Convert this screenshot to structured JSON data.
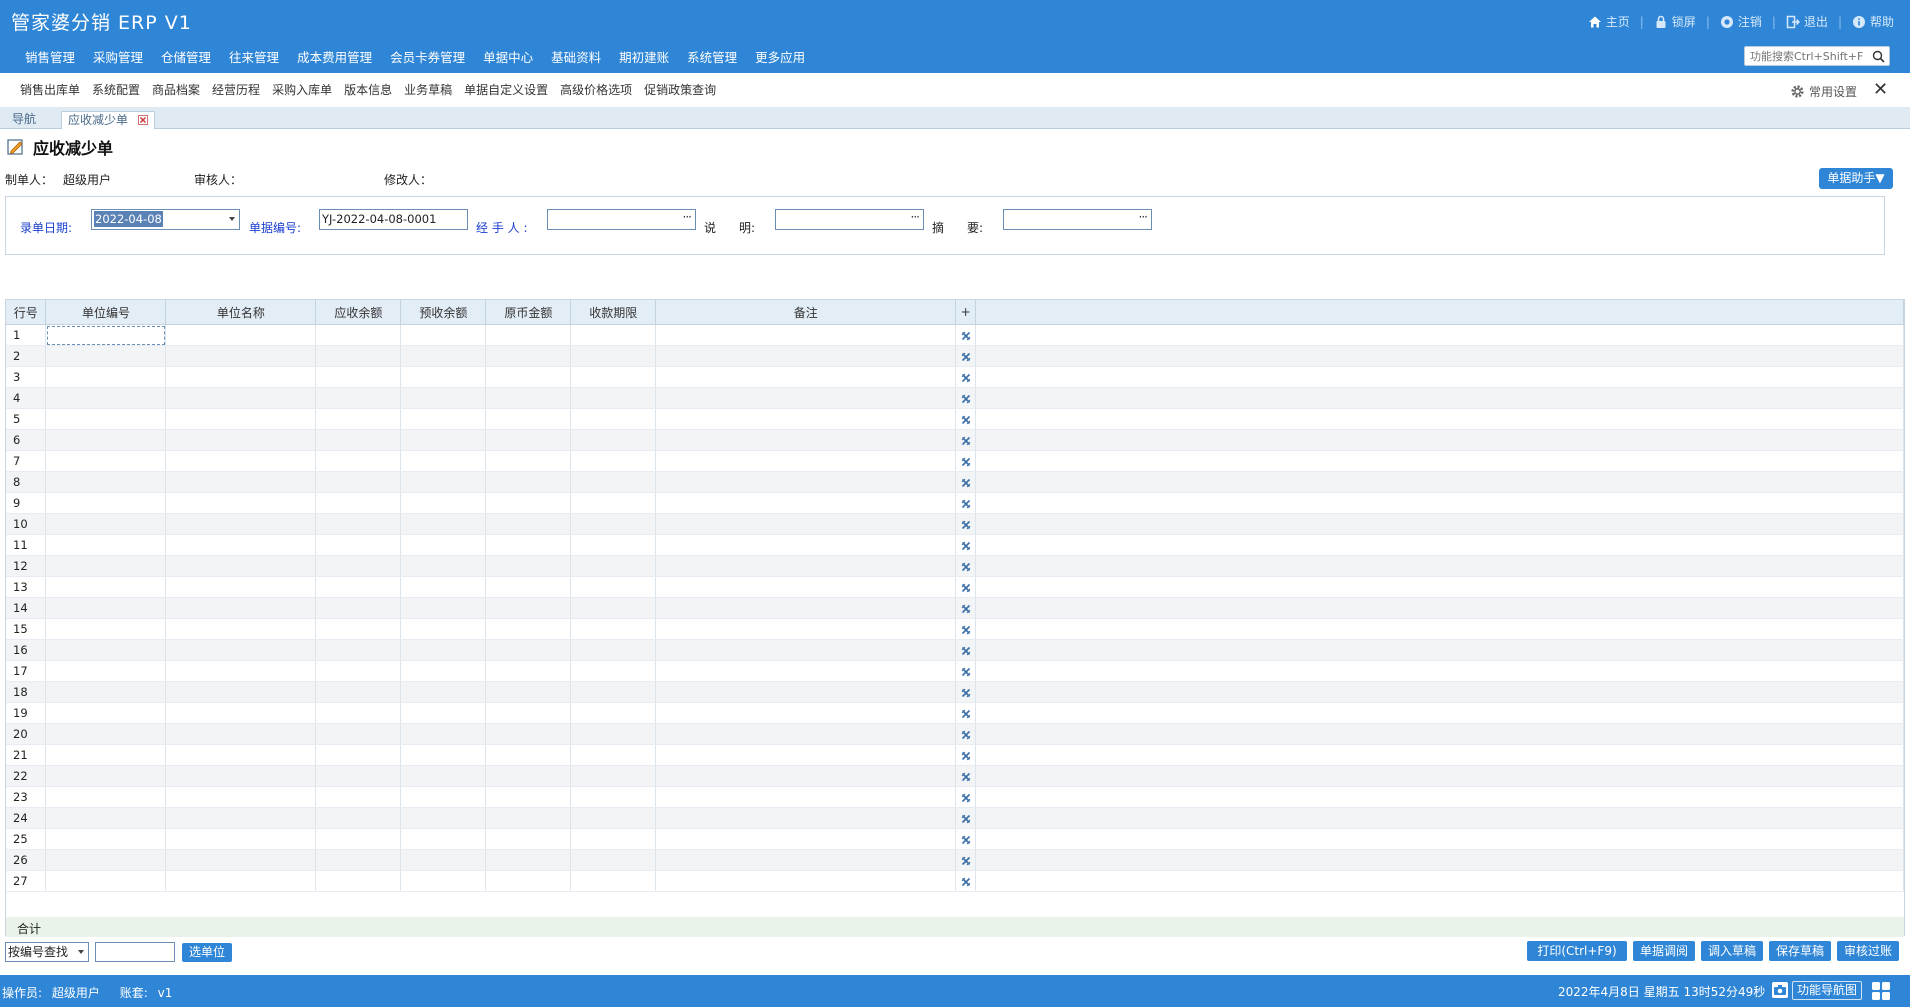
{
  "app": {
    "title": "管家婆分销 ERP V1"
  },
  "top_links": [
    {
      "label": "主页",
      "icon": "home-icon"
    },
    {
      "label": "锁屏",
      "icon": "lock-icon"
    },
    {
      "label": "注销",
      "icon": "logout-circle-icon"
    },
    {
      "label": "退出",
      "icon": "exit-icon"
    },
    {
      "label": "帮助",
      "icon": "info-icon"
    }
  ],
  "main_nav": [
    "销售管理",
    "采购管理",
    "仓储管理",
    "往来管理",
    "成本费用管理",
    "会员卡券管理",
    "单据中心",
    "基础资料",
    "期初建账",
    "系统管理",
    "更多应用"
  ],
  "search": {
    "placeholder": "功能搜索Ctrl+Shift+F"
  },
  "sub_nav": [
    "销售出库单",
    "系统配置",
    "商品档案",
    "经营历程",
    "采购入库单",
    "版本信息",
    "业务草稿",
    "单据自定义设置",
    "高级价格选项",
    "促销政策查询"
  ],
  "common_settings": "常用设置",
  "tabs": [
    {
      "label": "导航"
    },
    {
      "label": "应收减少单"
    }
  ],
  "document": {
    "title": "应收减少单",
    "creator_label": "制单人：",
    "creator_value": "超级用户",
    "auditor_label": "审核人：",
    "modifier_label": "修改人：",
    "helper_button": "单据助手▼"
  },
  "form": {
    "date_label": "录单日期:",
    "date_value": "2022-04-08",
    "number_label": "单据编号:",
    "number_value": "YJ-2022-04-08-0001",
    "handler_label": "经 手 人 :",
    "handler_value": "",
    "desc_label_1": "说",
    "desc_label_2": "明:",
    "desc_value": "",
    "summary_label_1": "摘",
    "summary_label_2": "要:",
    "summary_value": ""
  },
  "grid": {
    "headers": [
      "行号",
      "单位编号",
      "单位名称",
      "应收余额",
      "预收余额",
      "原币金额",
      "收款期限",
      "备注",
      "+"
    ],
    "row_count": 27,
    "total_label": "合计"
  },
  "bottom": {
    "lookup_option": "按编号查找",
    "select_unit_button": "选单位",
    "actions": [
      "打印(Ctrl+F9)",
      "单据调阅",
      "调入草稿",
      "保存草稿",
      "审核过账"
    ]
  },
  "status": {
    "operator_label": "操作员:",
    "operator_value": "超级用户",
    "account_label": "账套:",
    "account_value": "v1",
    "clock": "2022年4月8日  星期五  13时52分49秒",
    "nav_button": "功能导航图"
  },
  "colors": {
    "header_blue": "#2f86d6",
    "label_blue": "#1a3fcf",
    "grid_header": "#e3edf6",
    "total_row": "#e9f3ea"
  }
}
